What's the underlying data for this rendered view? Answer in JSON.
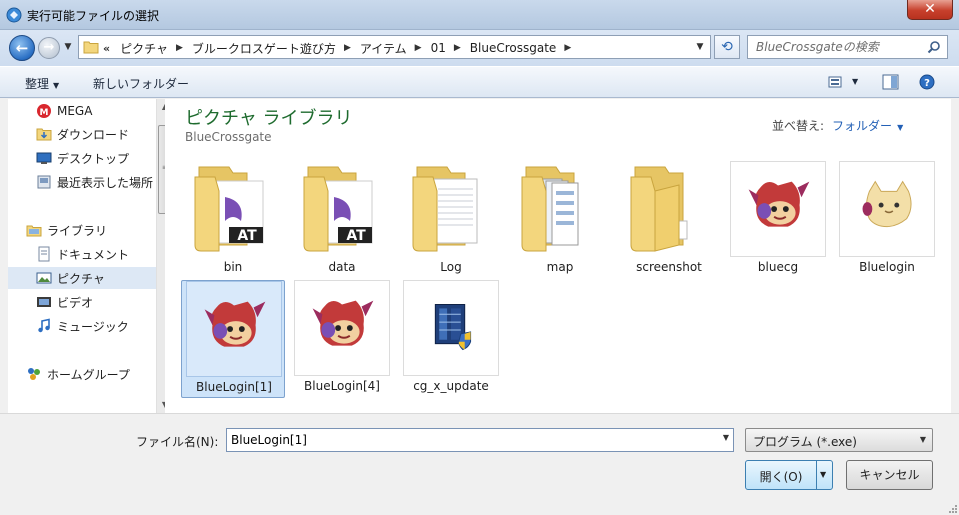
{
  "window": {
    "title": "実行可能ファイルの選択",
    "close_label": "✕"
  },
  "nav": {
    "back_icon": "arrow-left-icon",
    "forward_icon": "arrow-right-icon",
    "overflow": "«",
    "breadcrumbs": [
      "ピクチャ",
      "ブルークロスゲート遊び方",
      "アイテム",
      "01",
      "BlueCrossgate"
    ],
    "search_placeholder": "BlueCrossgateの検索"
  },
  "toolbar": {
    "organize_label": "整理",
    "new_folder_label": "新しいフォルダー"
  },
  "sidebar": {
    "items": [
      {
        "label": "MEGA",
        "icon": "mega-icon"
      },
      {
        "label": "ダウンロード",
        "icon": "download-folder-icon"
      },
      {
        "label": "デスクトップ",
        "icon": "desktop-icon"
      },
      {
        "label": "最近表示した場所",
        "icon": "recent-places-icon"
      },
      {
        "label": "ライブラリ",
        "icon": "library-icon"
      },
      {
        "label": "ドキュメント",
        "icon": "documents-icon"
      },
      {
        "label": "ピクチャ",
        "icon": "pictures-icon"
      },
      {
        "label": "ビデオ",
        "icon": "videos-icon"
      },
      {
        "label": "ミュージック",
        "icon": "music-icon"
      },
      {
        "label": "ホームグループ",
        "icon": "homegroup-icon"
      }
    ]
  },
  "main": {
    "library_title": "ピクチャ ライブラリ",
    "library_subtitle": "BlueCrossgate",
    "sort_label": "並べ替え:",
    "sort_value": "フォルダー",
    "items": [
      {
        "name": "bin",
        "type": "folder"
      },
      {
        "name": "data",
        "type": "folder"
      },
      {
        "name": "Log",
        "type": "folder"
      },
      {
        "name": "map",
        "type": "folder"
      },
      {
        "name": "screenshot",
        "type": "folder"
      },
      {
        "name": "bluecg",
        "type": "app-red"
      },
      {
        "name": "Bluelogin",
        "type": "app-yellow"
      },
      {
        "name": "BlueLogin[1]",
        "type": "app-red",
        "selected": true
      },
      {
        "name": "BlueLogin[4]",
        "type": "app-red"
      },
      {
        "name": "cg_x_update",
        "type": "installer"
      }
    ]
  },
  "bottom": {
    "filename_label": "ファイル名(N):",
    "filename_value": "BlueLogin[1]",
    "filetype_value": "プログラム (*.exe)",
    "open_label": "開く(O)",
    "cancel_label": "キャンセル"
  }
}
